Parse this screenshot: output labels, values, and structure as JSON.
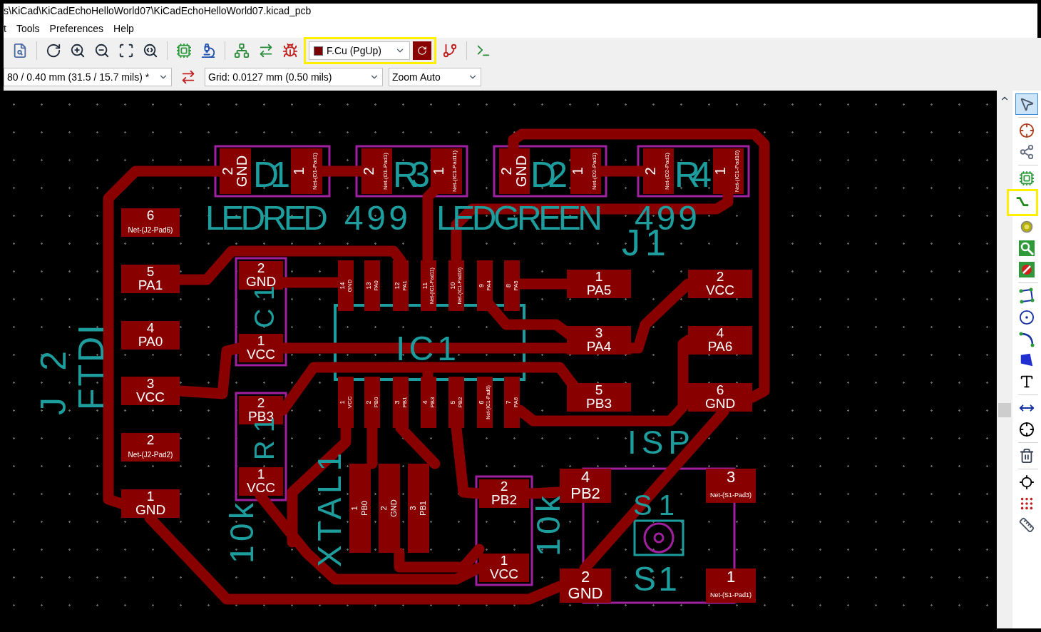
{
  "window": {
    "title": "s\\KiCad\\KiCadEchoHelloWorld07\\KiCadEchoHelloWorld07.kicad_pcb"
  },
  "menu": [
    {
      "label": "t"
    },
    {
      "label": "Tools"
    },
    {
      "label": "Preferences"
    },
    {
      "label": "Help"
    }
  ],
  "toolbar": {
    "layer": {
      "value": "F.Cu (PgUp)",
      "highlighted": true
    },
    "track_width": {
      "value": "80 / 0.40 mm (31.5 / 15.7 mils) *"
    },
    "grid": {
      "value": "Grid: 0.0127 mm (0.50 mils)"
    },
    "zoom": {
      "value": "Zoom Auto"
    }
  },
  "right_toolbar": [
    {
      "selected": true,
      "highlighted": false
    },
    {
      "selected": false,
      "highlighted": false
    },
    {
      "selected": false,
      "highlighted": false
    },
    {
      "selected": false,
      "highlighted": false
    },
    {
      "selected": false,
      "highlighted": true
    },
    {
      "selected": false,
      "highlighted": false
    },
    {
      "selected": false,
      "highlighted": false
    },
    {
      "selected": false,
      "highlighted": false
    },
    {
      "selected": false,
      "highlighted": false
    },
    {
      "selected": false,
      "highlighted": false
    },
    {
      "selected": false,
      "highlighted": false
    },
    {
      "selected": false,
      "highlighted": false
    },
    {
      "selected": false,
      "highlighted": false
    },
    {
      "selected": false,
      "highlighted": false
    },
    {
      "selected": false,
      "highlighted": false
    },
    {
      "selected": false,
      "highlighted": false
    },
    {
      "selected": false,
      "highlighted": false
    },
    {
      "selected": false,
      "highlighted": false
    },
    {
      "selected": false,
      "highlighted": false
    }
  ],
  "board": {
    "silkscreen": [
      {
        "text": "D1"
      },
      {
        "text": "R3"
      },
      {
        "text": "D2"
      },
      {
        "text": "R4"
      },
      {
        "text": "LEDRED"
      },
      {
        "text": "499"
      },
      {
        "text": "LEDGREEN"
      },
      {
        "text": "499"
      },
      {
        "text": "J1"
      },
      {
        "text": "IC1"
      },
      {
        "text": "J2"
      },
      {
        "text": "FTDI"
      },
      {
        "text": "ISP"
      },
      {
        "text": "S1"
      },
      {
        "text": "S1"
      },
      {
        "text": "10k"
      },
      {
        "text": "XTAL1"
      },
      {
        "text": "10k"
      },
      {
        "text": "R1"
      },
      {
        "text": "C1"
      }
    ],
    "pads": [
      {
        "number": "2",
        "net": "GND"
      },
      {
        "number": "1",
        "net": "Net-(D1-Pad1)"
      },
      {
        "number": "2",
        "net": "Net-(D1-Pad1)"
      },
      {
        "number": "1",
        "net": "Net-(IC1-Pad11)"
      },
      {
        "number": "2",
        "net": "GND"
      },
      {
        "number": "1",
        "net": "Net-(D2-Pad1)"
      },
      {
        "number": "2",
        "net": "Net-(D2-Pad1)"
      },
      {
        "number": "1",
        "net": "Net-(IC1-Pad10)"
      },
      {
        "number": "6",
        "net": "Net-(J2-Pad6)"
      },
      {
        "number": "5",
        "net": "PA1"
      },
      {
        "number": "4",
        "net": "PA0"
      },
      {
        "number": "3",
        "net": "VCC"
      },
      {
        "number": "2",
        "net": "Net-(J2-Pad2)"
      },
      {
        "number": "1",
        "net": "GND"
      },
      {
        "number": "2",
        "net": "GND"
      },
      {
        "number": "1",
        "net": "VCC"
      },
      {
        "number": "2",
        "net": "PB3"
      },
      {
        "number": "1",
        "net": "VCC"
      },
      {
        "number": "14",
        "net": "GND"
      },
      {
        "number": "13",
        "net": "PA0"
      },
      {
        "number": "12",
        "net": "PA1"
      },
      {
        "number": "11",
        "net": "Net-(IC1-Pad11)"
      },
      {
        "number": "10",
        "net": "Net-(IC1-Pad10)"
      },
      {
        "number": "9",
        "net": "PA4"
      },
      {
        "number": "8",
        "net": "PA5"
      },
      {
        "number": "1",
        "net": "VCC"
      },
      {
        "number": "2",
        "net": "PB0"
      },
      {
        "number": "3",
        "net": "PB1"
      },
      {
        "number": "4",
        "net": "PB3"
      },
      {
        "number": "5",
        "net": "PB2"
      },
      {
        "number": "6",
        "net": "Net-(IC1-Pad6)"
      },
      {
        "number": "7",
        "net": "PA6"
      },
      {
        "number": "1",
        "net": "PA5"
      },
      {
        "number": "2",
        "net": "VCC"
      },
      {
        "number": "3",
        "net": "PA4"
      },
      {
        "number": "4",
        "net": "PA6"
      },
      {
        "number": "5",
        "net": "PB3"
      },
      {
        "number": "6",
        "net": "GND"
      },
      {
        "number": "1",
        "net": "PB0"
      },
      {
        "number": "2",
        "net": "GND"
      },
      {
        "number": "3",
        "net": "PB1"
      },
      {
        "number": "2",
        "net": "PB2"
      },
      {
        "number": "1",
        "net": "VCC"
      },
      {
        "number": "4",
        "net": "PB2"
      },
      {
        "number": "3",
        "net": "Net-(S1-Pad3)"
      },
      {
        "number": "2",
        "net": "GND"
      },
      {
        "number": "1",
        "net": "Net-(S1-Pad1)"
      }
    ]
  }
}
